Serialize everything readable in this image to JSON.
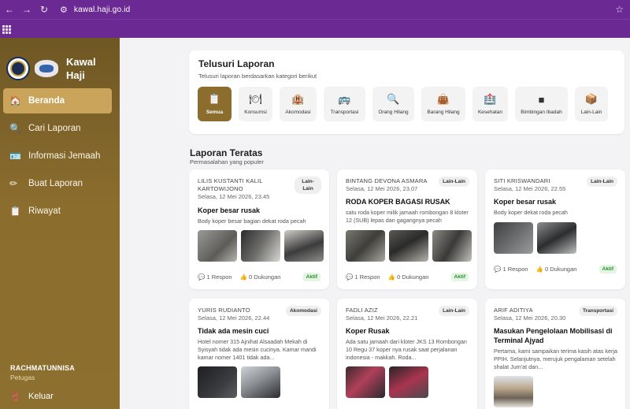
{
  "browser": {
    "url": "kawal.haji.go.id"
  },
  "sidebar": {
    "brand": "Kawal Haji",
    "items": [
      {
        "label": "Beranda",
        "icon": "home-icon",
        "active": true
      },
      {
        "label": "Cari Laporan",
        "icon": "search-icon"
      },
      {
        "label": "Informasi Jemaah",
        "icon": "id-card-icon"
      },
      {
        "label": "Buat Laporan",
        "icon": "pencil-icon"
      },
      {
        "label": "Riwayat",
        "icon": "clipboard-icon"
      }
    ],
    "user": {
      "name": "RACHMATUNNISA",
      "role": "Petugas"
    },
    "logout": "Keluar"
  },
  "browse": {
    "title": "Telusuri Laporan",
    "subtitle": "Telusuri laporan berdasarkan kategori berikut",
    "categories": [
      {
        "label": "Semua",
        "icon": "clipboard-icon"
      },
      {
        "label": "Konsumsi",
        "icon": "plate-icon"
      },
      {
        "label": "Akomodasi",
        "icon": "hotel-icon"
      },
      {
        "label": "Transportasi",
        "icon": "bus-icon"
      },
      {
        "label": "Orang Hilang",
        "icon": "magnifier-icon"
      },
      {
        "label": "Barang Hilang",
        "icon": "bag-icon"
      },
      {
        "label": "Kesehatan",
        "icon": "hospital-icon"
      },
      {
        "label": "Bimbingan Ibadah",
        "icon": "kaaba-icon"
      },
      {
        "label": "Lain-Lain",
        "icon": "box-icon"
      }
    ]
  },
  "top": {
    "title": "Laporan Teratas",
    "subtitle": "Permasalahan yang populer",
    "reports": [
      {
        "author": "LILIS KUSTANTI KALIL KARTOWIJONO",
        "date": "Selasa, 12 Mei 2026, 23.45",
        "category": "Lain-Lain",
        "title": "Koper besar rusak",
        "desc": "Body koper besar bagian dekat roda pecah",
        "responses": "1 Respon",
        "support": "0 Dukungan",
        "status": "Aktif"
      },
      {
        "author": "BINTANG DEVONA ASMARA",
        "date": "Selasa, 12 Mei 2026, 23.07",
        "category": "Lain-Lain",
        "title": "RODA KOPER BAGASI RUSAK",
        "desc": "satu roda koper milik jamaah rombongan 8 kloter 12 (SUB) lepas dan gagangnya pecah",
        "responses": "1 Respon",
        "support": "0 Dukungan",
        "status": "Aktif"
      },
      {
        "author": "SITI KRISWANDARI",
        "date": "Selasa, 12 Mei 2026, 22.55",
        "category": "Lain-Lain",
        "title": "Koper besar rusak",
        "desc": "Body koper dekat roda pecah",
        "responses": "1 Respon",
        "support": "0 Dukungan",
        "status": "Aktif"
      },
      {
        "author": "YURIS RUDIANTO",
        "date": "Selasa, 12 Mei 2026, 22.44",
        "category": "Akomodasi",
        "title": "Tidak ada mesin cuci",
        "desc": "Hotel nomer 315 Ajnihat Alsaadah Mekah di Syisyah tidak ada mesin cucinya. Kamar mandi kamar nomer 1401 tidak ada..."
      },
      {
        "author": "FADLI AZIZ",
        "date": "Selasa, 12 Mei 2026, 22.21",
        "category": "Lain-Lain",
        "title": "Koper Rusak",
        "desc": "Ada satu jamaah dari kloter JKS 13 Rombongan 10 Regu 37 koper nya rusak saat perjalanan indonesia - makkah. Roda..."
      },
      {
        "author": "ARIF ADITIYA",
        "date": "Selasa, 12 Mei 2026, 20.30",
        "category": "Transportasi",
        "title": "Masukan Pengelolaan Mobilisasi di Terminal Ajyad",
        "desc": "Pertama, kami sampaikan terima kasih atas kerja PPIH. Selanjutnya, merujuk pengalaman setelah shalat Jum'at dan..."
      }
    ]
  }
}
